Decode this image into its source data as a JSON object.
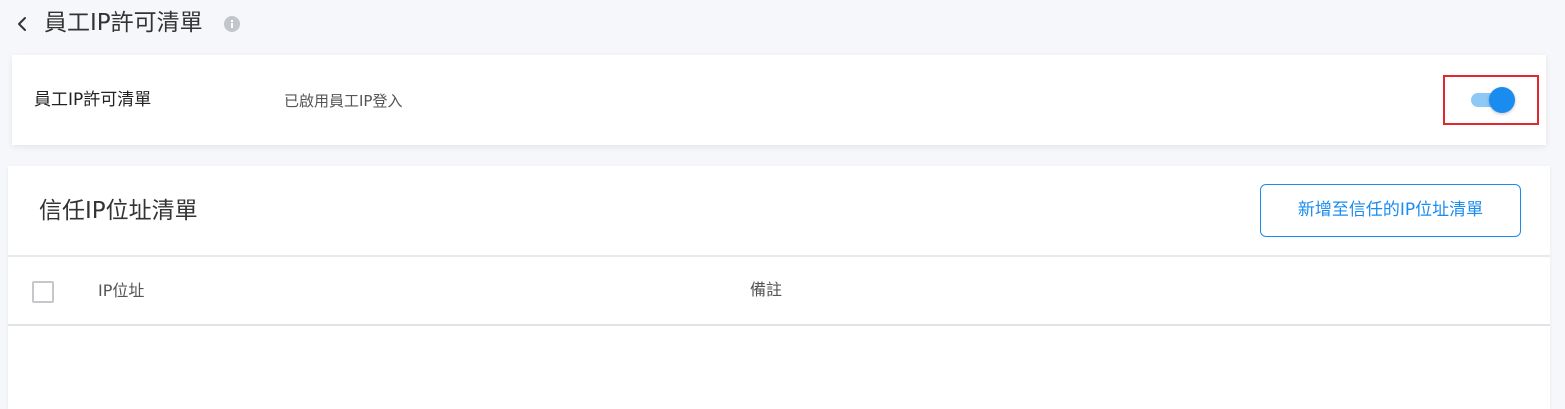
{
  "header": {
    "title": "員工IP許可清單",
    "back_icon": "chevron-left-icon",
    "info_icon": "info-icon"
  },
  "employee_ip_card": {
    "label": "員工IP許可清單",
    "status": "已啟用員工IP登入",
    "toggle_on": true,
    "toggle_color": "#1a8cf0",
    "highlight_color": "#e0282e"
  },
  "trusted_ip_card": {
    "title": "信任IP位址清單",
    "add_button_label": "新增至信任的IP位址清單",
    "table": {
      "columns": [
        "IP位址",
        "備註"
      ],
      "rows": []
    }
  }
}
